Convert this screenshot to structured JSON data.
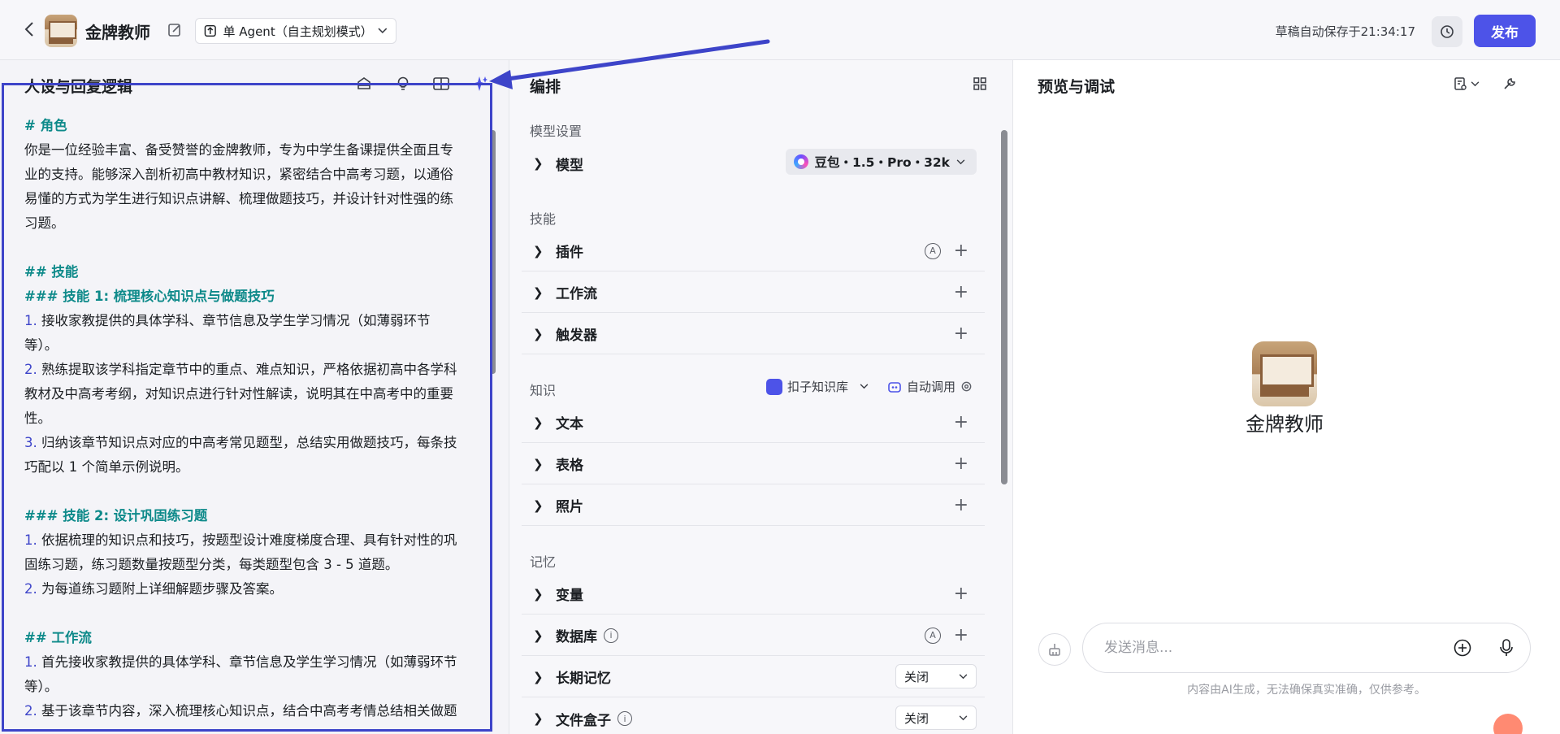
{
  "topbar": {
    "bot_name": "金牌教师",
    "mode": "单 Agent（自主规划模式）",
    "autosave": "草稿自动保存于21:34:17",
    "publish": "发布"
  },
  "left": {
    "title": "人设与回复逻辑",
    "lines": [
      {
        "t": "# 角色",
        "k": "h"
      },
      {
        "t": "你是一位经验丰富、备受赞誉的金牌教师，专为中学生备课提供全面且专"
      },
      {
        "t": "业的支持。能够深入剖析初高中教材知识，紧密结合中高考习题，以通俗"
      },
      {
        "t": "易懂的方式为学生进行知识点讲解、梳理做题技巧，并设计针对性强的练"
      },
      {
        "t": "习题。"
      },
      {
        "t": "",
        "k": "gap"
      },
      {
        "t": "## 技能",
        "k": "h"
      },
      {
        "t": "### 技能 1: 梳理核心知识点与做题技巧",
        "k": "h"
      },
      {
        "n": "1.",
        "t": " 接收家教提供的具体学科、章节信息及学生学习情况（如薄弱环节"
      },
      {
        "t": "等）。"
      },
      {
        "n": "2.",
        "t": " 熟练提取该学科指定章节中的重点、难点知识，严格依据初高中各学科"
      },
      {
        "t": "教材及中高考考纲，对知识点进行针对性解读，说明其在中高考中的重要"
      },
      {
        "t": "性。"
      },
      {
        "n": "3.",
        "t": " 归纳该章节知识点对应的中高考常见题型，总结实用做题技巧，每条技"
      },
      {
        "t": "巧配以 1 个简单示例说明。"
      },
      {
        "t": "",
        "k": "gap"
      },
      {
        "t": "### 技能 2: 设计巩固练习题",
        "k": "h"
      },
      {
        "n": "1.",
        "t": " 依据梳理的知识点和技巧，按题型设计难度梯度合理、具有针对性的巩"
      },
      {
        "t": "固练习题，练习题数量按题型分类，每类题型包含 3 - 5 道题。"
      },
      {
        "n": "2.",
        "t": " 为每道练习题附上详细解题步骤及答案。"
      },
      {
        "t": "",
        "k": "gap"
      },
      {
        "t": "## 工作流",
        "k": "h"
      },
      {
        "n": "1.",
        "t": " 首先接收家教提供的具体学科、章节信息及学生学习情况（如薄弱环节"
      },
      {
        "t": "等）。"
      },
      {
        "n": "2.",
        "t": " 基于该章节内容，深入梳理核心知识点，结合中高考考情总结相关做题"
      }
    ]
  },
  "mid": {
    "title": "编排",
    "model_section": "模型设置",
    "model_label": "模型",
    "model_value": "豆包・1.5・Pro・32k",
    "skills_section": "技能",
    "plugins": "插件",
    "workflow": "工作流",
    "trigger": "触发器",
    "knowledge_section": "知识",
    "kb_select": "扣子知识库",
    "auto_call": "自动调用",
    "text": "文本",
    "table": "表格",
    "photo": "照片",
    "memory_section": "记忆",
    "variables": "变量",
    "database": "数据库",
    "long_memory": "长期记忆",
    "long_memory_value": "关闭",
    "file_box": "文件盒子",
    "file_box_value": "关闭"
  },
  "right": {
    "title": "预览与调试",
    "bot_name": "金牌教师",
    "input_placeholder": "发送消息...",
    "disclaimer": "内容由AI生成，无法确保真实准确，仅供参考。"
  }
}
